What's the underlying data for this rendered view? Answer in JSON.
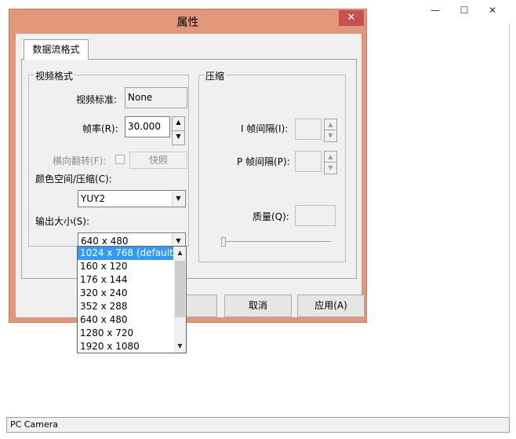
{
  "main_window": {
    "title_fragment": "",
    "minimize": "—",
    "maximize": "☐",
    "close": "✕",
    "status_text": "PC Camera"
  },
  "dialog": {
    "title": "属性",
    "close": "✕",
    "tab_label": "数据流格式",
    "video_format": {
      "group_label": "视频格式",
      "standard_label": "视频标准:",
      "standard_value": "None",
      "framerate_label": "帧率(R):",
      "framerate_value": "30.000",
      "flip_label": "横向翻转(F):",
      "snapshot_button": "快照",
      "colorspace_label": "颜色空间/压缩(C):",
      "colorspace_value": "YUY2",
      "output_size_label": "输出大小(S):",
      "output_size_value": "640 x 480"
    },
    "compression": {
      "group_label": "压缩",
      "iframe_label": "I 帧间隔(I):",
      "pframe_label": "P 帧间隔(P):",
      "quality_label": "质量(Q):",
      "quality_level": 0
    },
    "buttons": {
      "cancel": "取消",
      "apply": "应用(A)"
    }
  },
  "output_size_options": [
    "1024 x 768  (default)",
    "160 x 120",
    "176 x 144",
    "320 x 240",
    "352 x 288",
    "640 x 480",
    "1280 x 720",
    "1920 x 1080"
  ],
  "selected_index": 0,
  "colors": {
    "dialog_frame": "#e0977a",
    "selection": "#3399ff",
    "close_button": "#c75050"
  }
}
